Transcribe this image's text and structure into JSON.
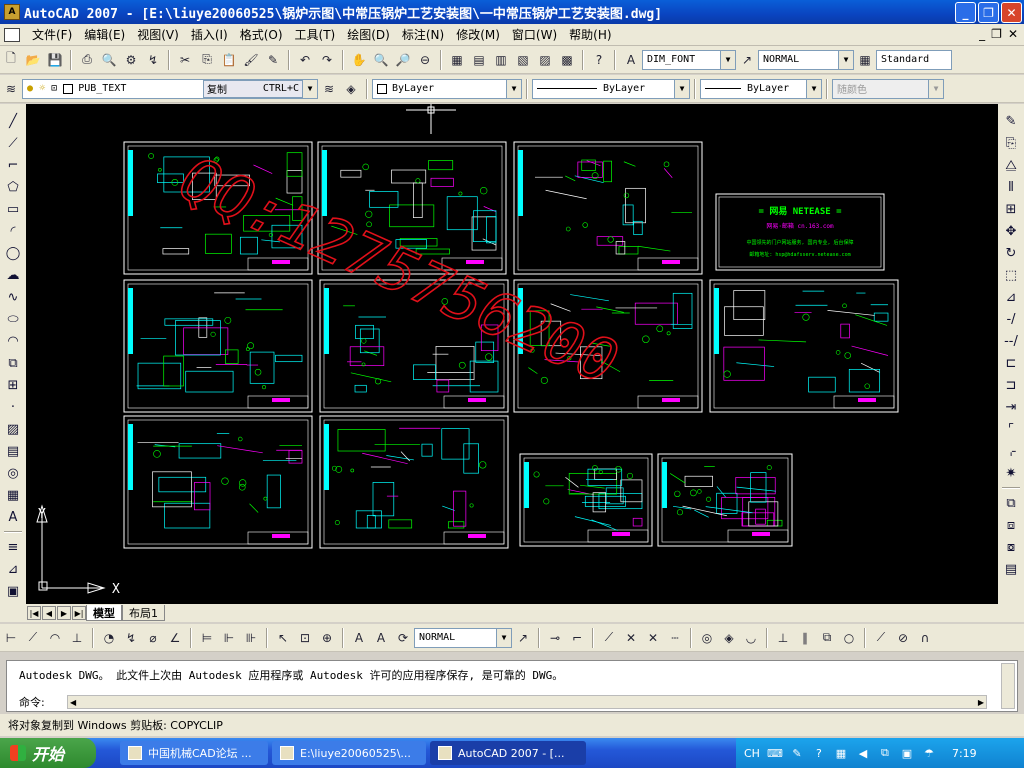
{
  "window": {
    "title": "AutoCAD 2007 - [E:\\liuye20060525\\锅炉示图\\中常压锅炉工艺安装图\\一中常压锅炉工艺安装图.dwg]"
  },
  "menu": {
    "items": [
      "文件(F)",
      "编辑(E)",
      "视图(V)",
      "插入(I)",
      "格式(O)",
      "工具(T)",
      "绘图(D)",
      "标注(N)",
      "修改(M)",
      "窗口(W)",
      "帮助(H)"
    ]
  },
  "toolbar1": {
    "dimstyle": "DIM_FONT",
    "tablestyle": "NORMAL",
    "textstyle": "Standard"
  },
  "toolbar2": {
    "layer": "PUB_TEXT",
    "copy_label": "复制",
    "copy_shortcut": "CTRL+C",
    "color": "ByLayer",
    "linetype": "ByLayer",
    "lineweight": "ByLayer",
    "plotstyle": "随颜色"
  },
  "tabs": {
    "model": "模型",
    "layout1": "布局1"
  },
  "dimbar": {
    "dimstyle": "NORMAL"
  },
  "command": {
    "history": "Autodesk DWG。  此文件上次由 Autodesk 应用程序或 Autodesk 许可的应用程序保存, 是可靠的 DWG。",
    "prompt": "命令:"
  },
  "status": {
    "text": "将对象复制到 Windows 剪贴板:  COPYCLIP"
  },
  "ucs": {
    "x": "X",
    "y": "Y"
  },
  "watermark": {
    "text": "QQ:1275756200",
    "color": "#e0101a"
  },
  "netease": {
    "title": "= 网易 NETEASE =",
    "line1": "网易·邮箱  cn.163.com",
    "line2": "中国领先的门户网站服务, 国内专业, 后台保障",
    "line3": "邮箱地址: hsp@hdafsserv.netease.com"
  },
  "taskbar": {
    "start": "开始",
    "tasks": [
      "中国机械CAD论坛 ...",
      "E:\\liuye20060525\\...",
      "AutoCAD 2007 - [..."
    ],
    "ime": "CH",
    "clock": "7:19"
  },
  "colors": {
    "canvas": "#000000",
    "sheet_frame": "#ffffff",
    "cyan": "#00ffff",
    "green": "#00ff00",
    "magenta": "#ff00ff",
    "red": "#ff0000"
  }
}
